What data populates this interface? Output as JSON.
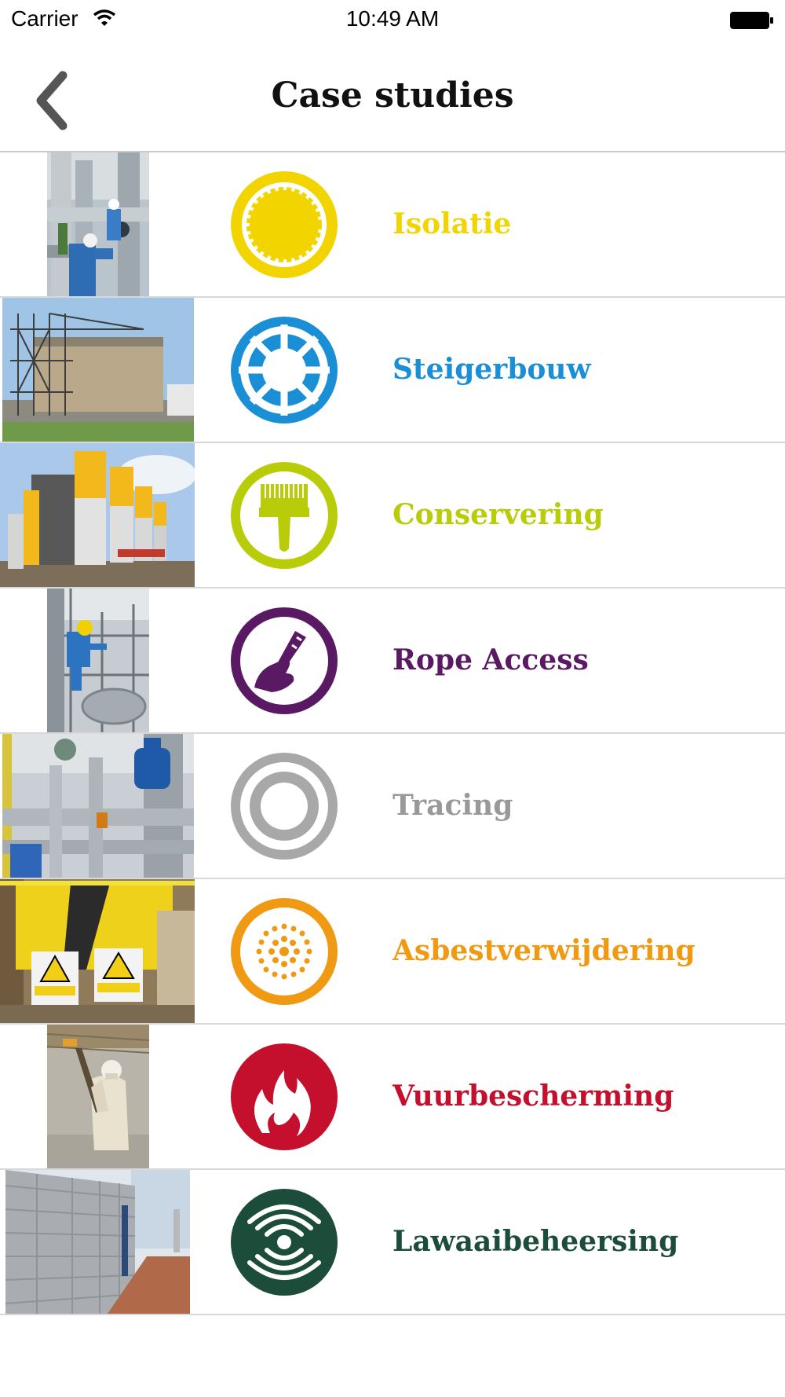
{
  "status_bar": {
    "carrier": "Carrier",
    "time": "10:49 AM"
  },
  "header": {
    "title": "Case studies",
    "back_icon": "chevron-left-icon"
  },
  "items": [
    {
      "label": "Isolatie",
      "color": "#f2d500",
      "icon": "insulation-icon",
      "photo": "pipe-workers-photo"
    },
    {
      "label": "Steigerbouw",
      "color": "#1a8fd6",
      "icon": "scaffolding-icon",
      "photo": "storage-tank-scaffold-photo"
    },
    {
      "label": "Conservering",
      "color": "#b8cc0a",
      "icon": "paint-brush-icon",
      "photo": "yellow-columns-photo"
    },
    {
      "label": "Rope Access",
      "color": "#5a1a63",
      "icon": "rope-access-icon",
      "photo": "rope-worker-photo"
    },
    {
      "label": "Tracing",
      "color": "#999999",
      "icon": "tracing-rings-icon",
      "photo": "valves-photo"
    },
    {
      "label": "Asbestverwijdering",
      "color": "#ef9a12",
      "icon": "asbestos-dots-icon",
      "photo": "asbestos-signs-photo"
    },
    {
      "label": "Vuurbescherming",
      "color": "#c4102c",
      "icon": "flame-icon",
      "photo": "spray-worker-photo"
    },
    {
      "label": "Lawaaibeheersing",
      "color": "#1c4d3a",
      "icon": "sound-waves-icon",
      "photo": "noise-wall-photo"
    }
  ]
}
